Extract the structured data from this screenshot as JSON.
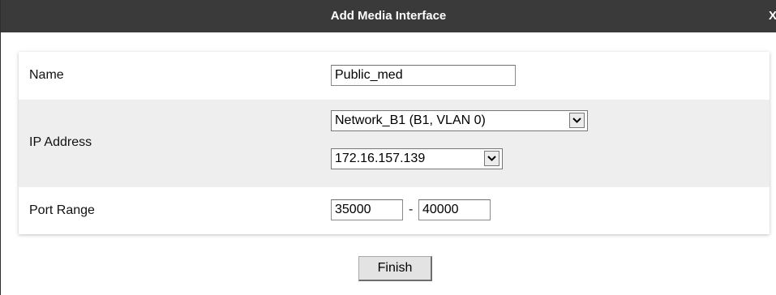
{
  "dialog": {
    "title": "Add Media Interface",
    "close_label": "X"
  },
  "form": {
    "name": {
      "label": "Name",
      "value": "Public_med"
    },
    "ip_address": {
      "label": "IP Address",
      "network_selected": "Network_B1 (B1, VLAN 0)",
      "ip_selected": "172.16.157.139"
    },
    "port_range": {
      "label": "Port Range",
      "start": "35000",
      "separator": "-",
      "end": "40000"
    }
  },
  "actions": {
    "finish_label": "Finish"
  }
}
